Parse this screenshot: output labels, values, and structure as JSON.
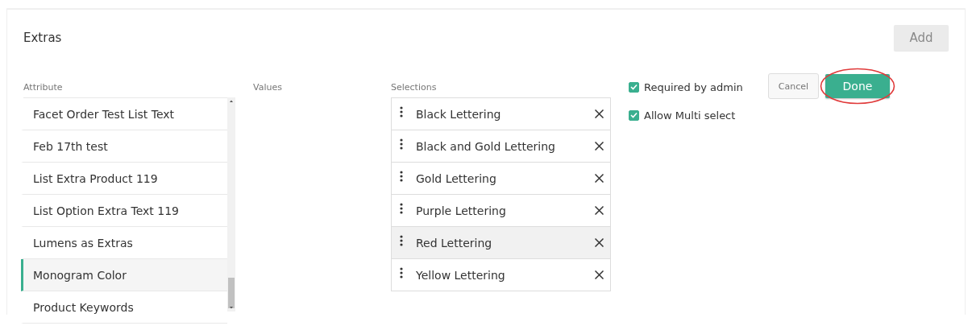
{
  "title": "Extras",
  "add_button": {
    "label": "Add",
    "disabled": true
  },
  "columns": {
    "attribute": "Attribute",
    "values": "Values",
    "selections": "Selections"
  },
  "attributes": [
    {
      "label": "Facet Order Test List Text",
      "selected": false
    },
    {
      "label": "Feb 17th test",
      "selected": false
    },
    {
      "label": "List Extra Product 119",
      "selected": false
    },
    {
      "label": "List Option Extra Text 119",
      "selected": false
    },
    {
      "label": "Lumens as Extras",
      "selected": false
    },
    {
      "label": "Monogram Color",
      "selected": true
    },
    {
      "label": "Product Keywords",
      "selected": false
    }
  ],
  "selections": [
    {
      "label": "Black Lettering",
      "highlighted": false
    },
    {
      "label": "Black and Gold Lettering",
      "highlighted": false
    },
    {
      "label": "Gold Lettering",
      "highlighted": false
    },
    {
      "label": "Purple Lettering",
      "highlighted": false
    },
    {
      "label": "Red Lettering",
      "highlighted": true
    },
    {
      "label": "Yellow Lettering",
      "highlighted": false
    }
  ],
  "options": [
    {
      "label": "Required by admin",
      "checked": true
    },
    {
      "label": "Allow Multi select",
      "checked": true
    }
  ],
  "cancel_button": {
    "label": "Cancel"
  },
  "done_button": {
    "label": "Done",
    "circled": true
  }
}
